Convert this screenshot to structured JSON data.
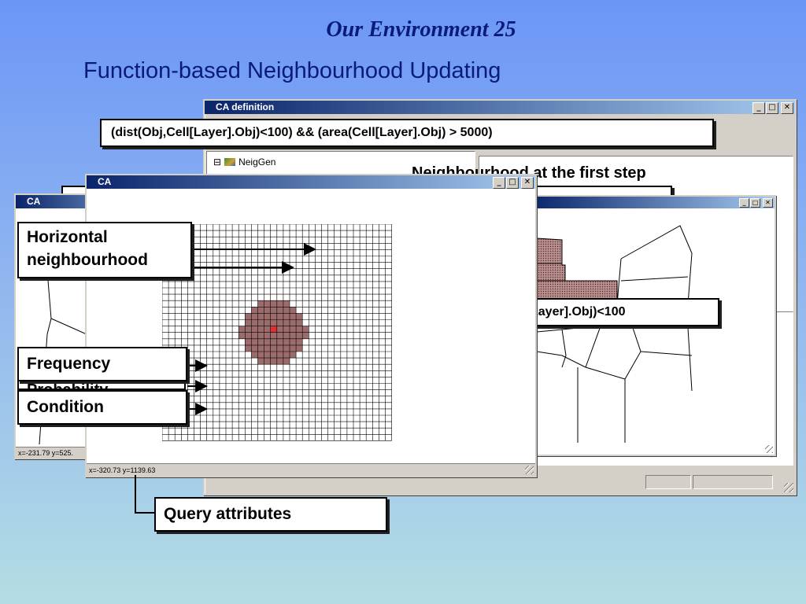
{
  "slide": {
    "title": "Our Environment 25",
    "subtitle": "Function-based Neighbourhood Updating"
  },
  "ca_definition_window": {
    "title": "CA definition",
    "tree_item": "NeigGen",
    "heading": "Neighbourhood at the first step",
    "top_expression": "(dist(Obj,Cell[Layer].Obj)<100) && (area(Cell[Layer].Obj) > 5000)"
  },
  "ca_window_front": {
    "title": "CA",
    "status": "x=-320.73   y=1139.63"
  },
  "ca_window_back": {
    "title": "CA",
    "status": "x=-231.79   y=525."
  },
  "callouts": {
    "horizontal": "Horizontal neighbourhood",
    "frequency": "Frequency",
    "probability": "Probability",
    "condition": "Condition",
    "query": "Query attributes",
    "dist": "dist(Obj, Cell[Layer].Obj)<100"
  },
  "glyphs": {
    "minimize": "_",
    "maximize": "□",
    "close": "✕",
    "tree_expand": "⊟"
  },
  "colors": {
    "title_bar_active": "#0a246a",
    "highlight_cells": "#9c6b6b",
    "center_cell": "#e03030"
  }
}
